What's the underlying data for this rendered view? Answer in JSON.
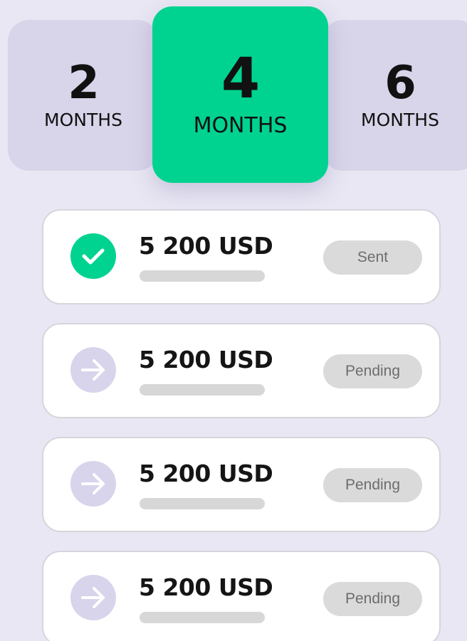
{
  "colors": {
    "background": "#E9E7F3",
    "card_inactive": "#D8D4E9",
    "accent_green": "#00D390",
    "pending_icon_bg": "#D8D4EC",
    "badge_bg": "#DADADA"
  },
  "durations": [
    {
      "number": "2",
      "unit": "MONTHS",
      "selected": false
    },
    {
      "number": "4",
      "unit": "MONTHS",
      "selected": true
    },
    {
      "number": "6",
      "unit": "MONTHS",
      "selected": false
    }
  ],
  "payments": [
    {
      "amount": "5 200 USD",
      "status": "Sent",
      "icon": "check-icon"
    },
    {
      "amount": "5 200 USD",
      "status": "Pending",
      "icon": "arrow-right-icon"
    },
    {
      "amount": "5 200 USD",
      "status": "Pending",
      "icon": "arrow-right-icon"
    },
    {
      "amount": "5 200 USD",
      "status": "Pending",
      "icon": "arrow-right-icon"
    }
  ]
}
